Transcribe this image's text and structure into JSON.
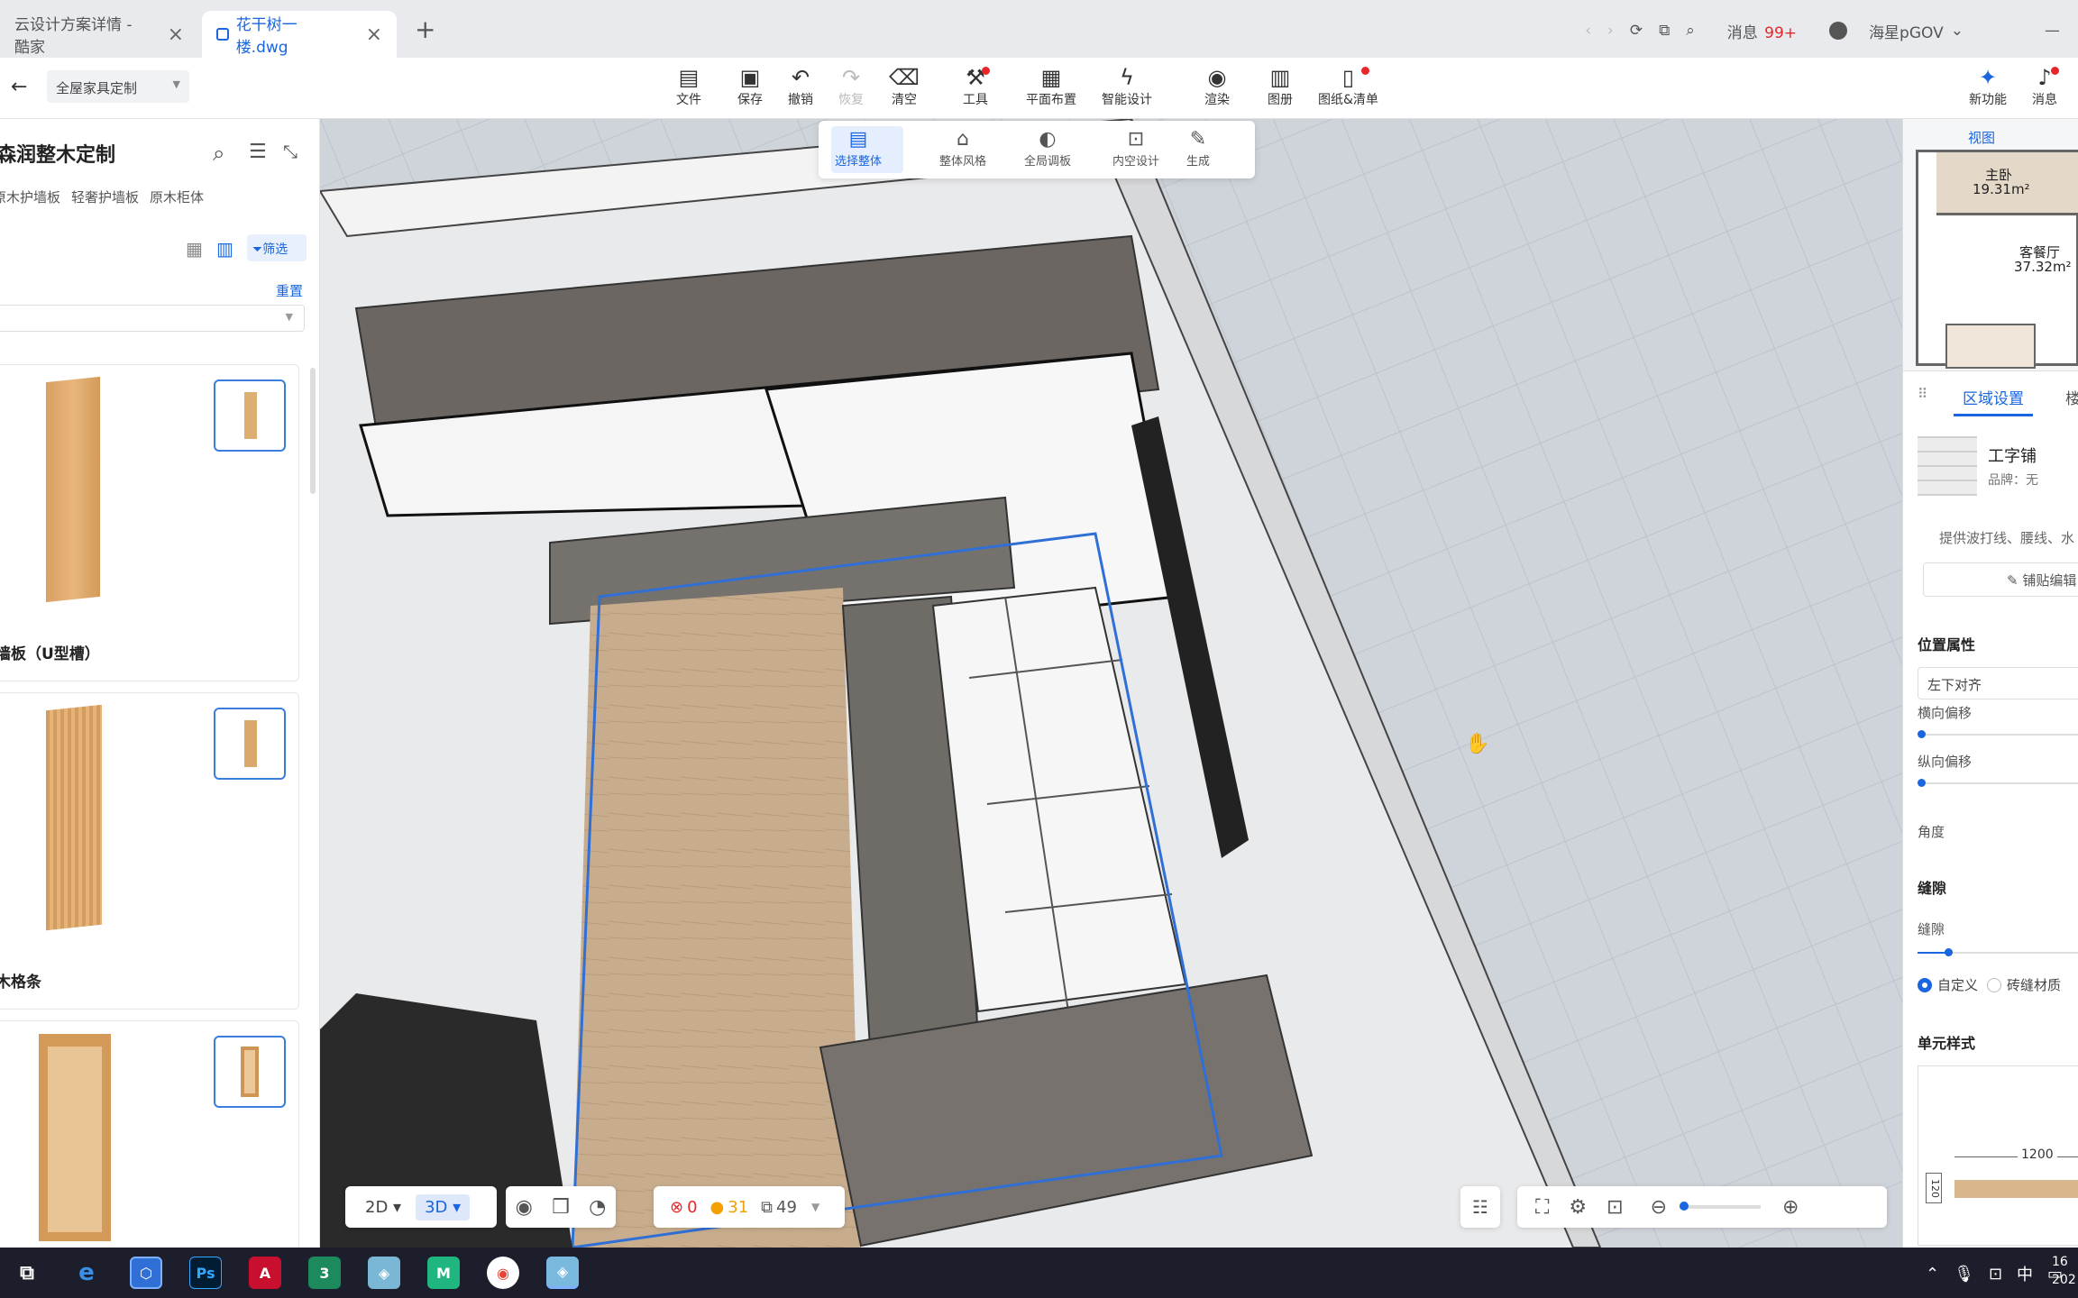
{
  "browser": {
    "tabs": [
      {
        "label": "云设计方案详情 - 酷家",
        "active": false
      },
      {
        "label": "花干树一楼.dwg",
        "active": true
      }
    ],
    "new_tab": "+",
    "messages_label": "消息",
    "messages_count": "99+",
    "user": "海星pGOV",
    "minimize": "—"
  },
  "app_toolbar": {
    "back": "←",
    "mode_select": "全屋家具定制",
    "tools": [
      {
        "label": "文件",
        "icon": "file-icon"
      },
      {
        "label": "保存",
        "icon": "save-icon"
      },
      {
        "label": "撤销",
        "icon": "undo-icon"
      },
      {
        "label": "恢复",
        "icon": "redo-icon"
      },
      {
        "label": "清空",
        "icon": "eraser-icon"
      },
      {
        "label": "工具",
        "icon": "wrench-icon"
      },
      {
        "label": "平面布置",
        "icon": "layout-icon"
      },
      {
        "label": "智能设计",
        "icon": "lightning-icon"
      },
      {
        "label": "渲染",
        "icon": "camera-icon"
      },
      {
        "label": "图册",
        "icon": "album-icon"
      },
      {
        "label": "图纸&清单",
        "icon": "drawing-icon"
      }
    ],
    "right_tools": [
      {
        "label": "新功能",
        "icon": "new-feature-icon"
      },
      {
        "label": "消息",
        "icon": "bell-icon"
      }
    ]
  },
  "sub_toolbar": {
    "tools": [
      {
        "label": "选择整体"
      },
      {
        "label": "整体风格"
      },
      {
        "label": "全局调板"
      },
      {
        "label": "内空设计"
      },
      {
        "label": "生成"
      }
    ]
  },
  "left_panel": {
    "title": "森润整木定制",
    "categories": [
      "原木护墙板",
      "轻奢护墙板",
      "原木柜体"
    ],
    "filter_label": "筛选",
    "reset_label": "重置",
    "products": [
      {
        "name": "墙板（U型槽）"
      },
      {
        "name": "木格条"
      },
      {
        "name": ""
      }
    ]
  },
  "bottom_bar": {
    "view_2d": "2D",
    "view_3d": "3D",
    "errors": "0",
    "warnings": "31",
    "items": "49"
  },
  "minimap": {
    "tab": "视图",
    "rooms": [
      {
        "name": "主卧",
        "area": "19.31m²"
      },
      {
        "name": "客餐厅",
        "area": "37.32m²"
      }
    ]
  },
  "right_panel": {
    "tab_active": "区域设置",
    "tab_other": "楼",
    "material_name": "工字铺",
    "brand": "品牌：无",
    "hint": "提供波打线、腰线、水",
    "edit_button": "铺贴编辑",
    "position_section": "位置属性",
    "align_value": "左下对齐",
    "h_offset": "横向偏移",
    "v_offset": "纵向偏移",
    "angle": "角度",
    "gap_section": "缝隙",
    "gap": "缝隙",
    "radio_custom": "自定义",
    "radio_tile": "砖缝材质",
    "unit_style": "单元样式",
    "dim_width": "1200",
    "dim_height": "120"
  },
  "taskbar": {
    "ime": "中",
    "time": "16",
    "date": "202"
  }
}
